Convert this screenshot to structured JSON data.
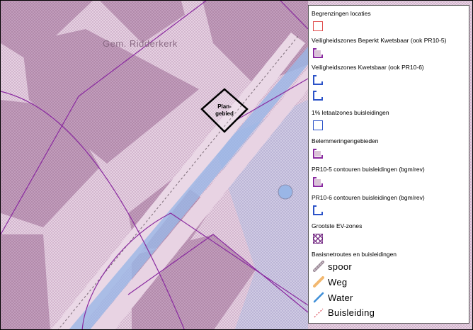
{
  "map": {
    "place_label": "Gem. Ridderkerk",
    "plan_label_line1": "Plan-",
    "plan_label_line2": "gebied",
    "colors": {
      "base": "#f3e6f0",
      "built": "#c9a9c3",
      "building_dark": "#b48fae",
      "water": "#9ab6e6",
      "contour": "#8a2aa0",
      "zone_fill": "#d9c3d6"
    }
  },
  "legend": {
    "items": [
      {
        "label": "Begrenzingen locaties",
        "symbol": "red-square-outline"
      },
      {
        "label": "Veiligheidszones Beperkt Kwetsbaar (ook PR10-5)",
        "symbol": "purple-bracket"
      },
      {
        "label": "Veiligheidszones Kwetsbaar (ook PR10-6)",
        "symbol": "blue-bracket"
      },
      {
        "label": "1% letaalzones buisleidingen",
        "symbol": "blue-square-outline"
      },
      {
        "label": "Belemmeringengebieden",
        "symbol": "purple-bracket"
      },
      {
        "label": "PR10-5 contouren buisleidingen (bgm/rev)",
        "symbol": "purple-bracket"
      },
      {
        "label": "PR10-6 contouren buisleidingen (bgm/rev)",
        "symbol": "blue-bracket"
      },
      {
        "label": "Grootste EV-zones",
        "symbol": "checker-square"
      }
    ],
    "routes_title": "Basisnetroutes en buisleidingen",
    "routes": [
      {
        "label": "spoor",
        "symbol": "rail-line"
      },
      {
        "label": "Weg",
        "symbol": "road-line"
      },
      {
        "label": "Water",
        "symbol": "water-line"
      },
      {
        "label": "Buisleiding",
        "symbol": "pipeline-line"
      }
    ]
  }
}
